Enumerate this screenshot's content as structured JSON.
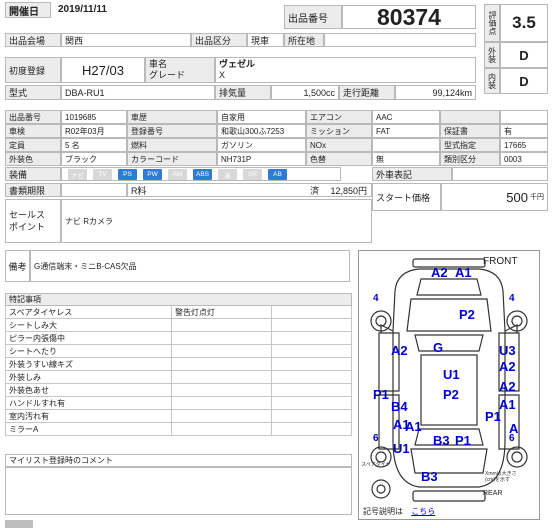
{
  "header": {
    "date_label": "開催日",
    "date_value": "2019/11/11",
    "lot_label": "出品番号",
    "lot_value": "80374",
    "hall_label": "出品会場",
    "hall_value": "関西",
    "section_label": "出品区分",
    "section_value": "現車",
    "location_label": "所在地",
    "location_value": ""
  },
  "evaluation": {
    "score_label": "評価点",
    "score_value": "3.5",
    "exterior_label": "外装",
    "exterior_value": "D",
    "interior_label": "内装",
    "interior_value": "D"
  },
  "vehicle": {
    "first_reg_label": "初度登録",
    "first_reg_value": "H27/03",
    "name_label": "車名",
    "grade_label": "グレード",
    "name_value": "ヴェゼル",
    "grade_value": "X",
    "model_label": "型式",
    "model_value": "DBA-RU1",
    "displacement_label": "排気量",
    "displacement_value": "1,500cc",
    "mileage_label": "走行距離",
    "mileage_value": "99,124km"
  },
  "specs": [
    {
      "l1": "出品番号",
      "v1": "1019685",
      "l2": "車歴",
      "v2": "自家用",
      "l3": "エアコン",
      "v3": "AAC",
      "l4": "",
      "v4": ""
    },
    {
      "l1": "車検",
      "v1": "R02年03月",
      "l2": "登録番号",
      "v2": "和歌山300ふ7253",
      "l3": "ミッション",
      "v3": "FAT",
      "l4": "保証書",
      "v4": "有"
    },
    {
      "l1": "定員",
      "v1": "5 名",
      "l2": "燃料",
      "v2": "ガソリン",
      "l3": "NOx",
      "v3": "",
      "l4": "型式指定",
      "v4": "17665"
    },
    {
      "l1": "外装色",
      "v1": "ブラック",
      "l2": "カラーコード",
      "v2": "NH731P",
      "l3": "色替",
      "v3": "無",
      "l4": "類別区分",
      "v4": "0003"
    }
  ],
  "equipment": {
    "label": "装備",
    "items": [
      {
        "name": "ナビ",
        "on": false
      },
      {
        "name": "TV",
        "on": false
      },
      {
        "name": "PS",
        "on": true
      },
      {
        "name": "PW",
        "on": true
      },
      {
        "name": "AW",
        "on": false
      },
      {
        "name": "ABS",
        "on": true
      },
      {
        "name": "革",
        "on": false
      },
      {
        "name": "SR",
        "on": false
      },
      {
        "name": "AB",
        "on": true
      }
    ],
    "outer_label": "外車表記",
    "outer_value": ""
  },
  "documents": {
    "label": "書類期限",
    "value": "",
    "recycle_label": "R料",
    "recycle_done": "済",
    "recycle_value": "12,850円",
    "start_price_label": "スタート価格",
    "start_price_value": "500",
    "start_price_unit": "千円"
  },
  "sales_point": {
    "label": "セールス\nポイント",
    "value": "ナビ Rカメラ"
  },
  "notes": {
    "label": "備考",
    "value": "G通信端末・ミニB-CAS欠品"
  },
  "special": {
    "header": "特記事項",
    "rows": [
      [
        "スペアタイヤレス",
        "警告灯点灯"
      ],
      [
        "シートしみ大",
        ""
      ],
      [
        "ピラー内張傷中",
        ""
      ],
      [
        "シートへたり",
        ""
      ],
      [
        "外装うすい線キズ",
        ""
      ],
      [
        "外装しみ",
        ""
      ],
      [
        "外装色あせ",
        ""
      ],
      [
        "ハンドルすれ有",
        ""
      ],
      [
        "室内汚れ有",
        ""
      ],
      [
        "ミラーA",
        ""
      ]
    ]
  },
  "mileage_comment": {
    "label": "マイリスト登録時のコメント",
    "value": ""
  },
  "diagram": {
    "front_label": "FRONT",
    "rear_label": "REAR",
    "spare_label": "スペアタイヤ",
    "note_label": "Xmmは大きさ\n(cm)を示す",
    "marks": [
      "A2",
      "A1",
      "P2",
      "A2",
      "G",
      "U3",
      "A2",
      "U1",
      "P2",
      "P1",
      "B4",
      "A1",
      "P1",
      "A2",
      "A1",
      "A1",
      "B3",
      "P1",
      "U1",
      "A",
      "B3"
    ],
    "numbers": [
      "4",
      "4",
      "6",
      "6"
    ],
    "legend_label": "記号説明は",
    "legend_link": "こちら"
  }
}
